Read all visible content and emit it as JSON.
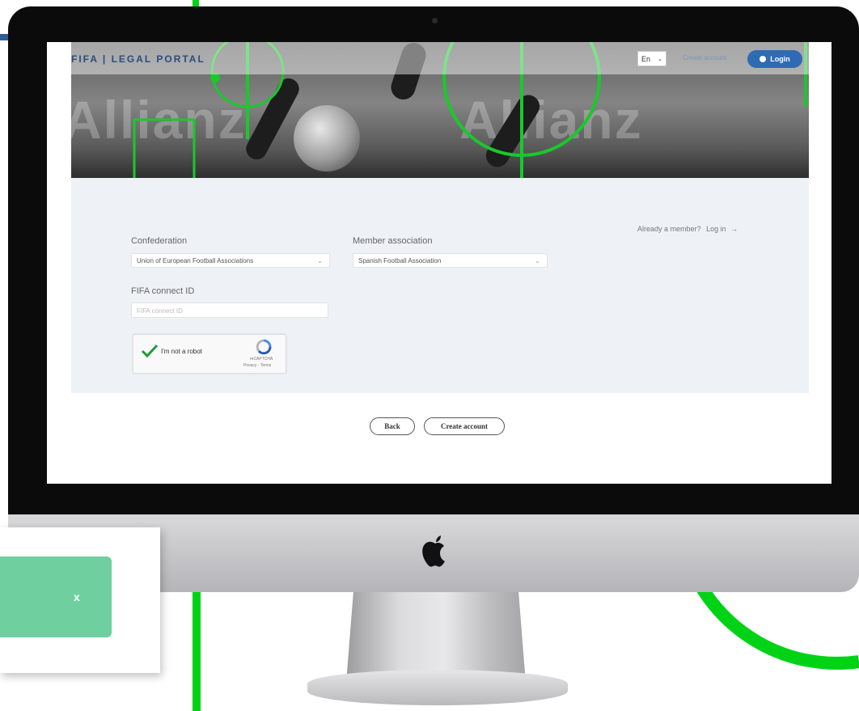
{
  "window": {
    "logo": "FIFA | LEGAL PORTAL",
    "language": "En",
    "nav_link": "Create account",
    "login_label": "Login"
  },
  "hero": {
    "background_text_left": "Allianz",
    "background_text_right": "Allianz"
  },
  "form": {
    "already_member": "Already a member?",
    "login_link": "Log in",
    "confederation_label": "Confederation",
    "confederation_value": "Union of European Football Associations",
    "member_association_label": "Member association",
    "member_association_value": "Spanish Football Association",
    "fifa_connect_label": "FIFA connect ID",
    "fifa_connect_placeholder": "FIFA connect ID",
    "captcha_text": "I'm not a robot",
    "captcha_brand": "reCAPTCHA",
    "captcha_terms": "Privacy - Terms"
  },
  "actions": {
    "back_label": "Back",
    "create_label": "Create account"
  },
  "notification": {
    "close_label": "x"
  },
  "colors": {
    "accent_green": "#00d316",
    "toast_green": "#6fcf9f",
    "login_blue": "#2f6bb5",
    "panel_bg": "#eef2f7"
  },
  "icons": [
    "apple-logo-icon",
    "chevron-down-icon",
    "check-icon",
    "recaptcha-icon",
    "login-icon",
    "arrow-right-icon"
  ]
}
